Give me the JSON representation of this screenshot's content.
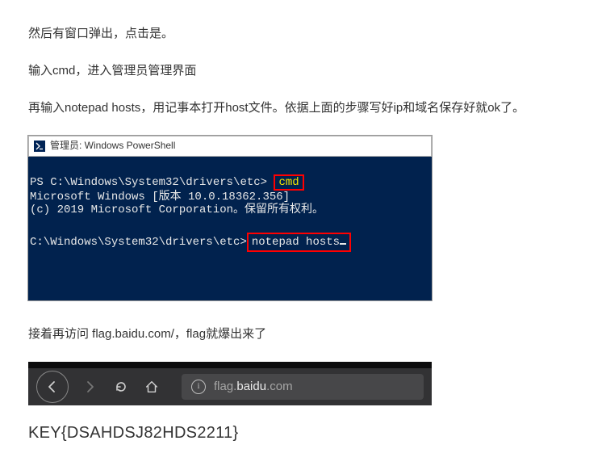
{
  "paragraphs": {
    "p1": "然后有窗口弹出，点击是。",
    "p2": "输入cmd，进入管理员管理界面",
    "p3": "再输入notepad hosts，用记事本打开host文件。依据上面的步骤写好ip和域名保存好就ok了。",
    "p4": "接着再访问 flag.baidu.com/，flag就爆出来了"
  },
  "powershell": {
    "title": "管理员: Windows PowerShell",
    "line1_prefix": "PS C:\\Windows\\System32\\drivers\\etc>",
    "line1_cmd": "cmd",
    "line2": "Microsoft Windows [版本 10.0.18362.356]",
    "line3": "(c) 2019 Microsoft Corporation。保留所有权利。",
    "line4_prefix": "C:\\Windows\\System32\\drivers\\etc>",
    "line4_cmd": "notepad hosts"
  },
  "browser": {
    "url_plain": "flag.",
    "url_domain": "baidu",
    "url_suffix": ".com"
  },
  "flag": "KEY{DSAHDSJ82HDS2211}"
}
